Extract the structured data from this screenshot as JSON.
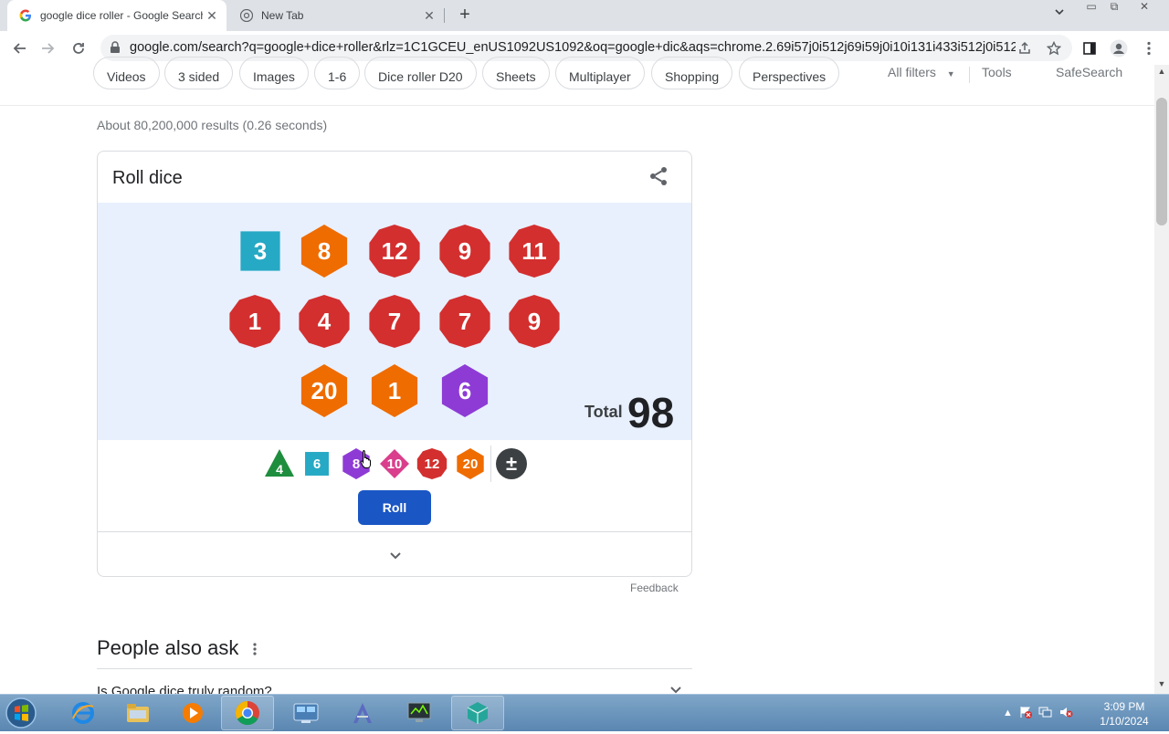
{
  "browser": {
    "tabs": [
      {
        "title": "google dice roller - Google Search",
        "active": true
      },
      {
        "title": "New Tab",
        "active": false
      }
    ],
    "url": "google.com/search?q=google+dice+roller&rlz=1C1GCEU_enUS1092US1092&oq=google+dic&aqs=chrome.2.69i57j0i512j69i59j0i10i131i433i512j0i512l4j..."
  },
  "search": {
    "chips": [
      "Videos",
      "3 sided",
      "Images",
      "1-6",
      "Dice roller D20",
      "Sheets",
      "Multiplayer",
      "Shopping",
      "Perspectives"
    ],
    "all_filters": "All filters",
    "tools": "Tools",
    "safesearch": "SafeSearch",
    "result_stats": "About 80,200,000 results (0.26 seconds)"
  },
  "dice_card": {
    "title": "Roll dice",
    "rolled_dice": [
      {
        "value": "3",
        "sides": 6,
        "color": "#26a9c4"
      },
      {
        "value": "8",
        "sides": 8,
        "color": "#ef6c00"
      },
      {
        "value": "12",
        "sides": 12,
        "color": "#d32f2f"
      },
      {
        "value": "9",
        "sides": 12,
        "color": "#d32f2f"
      },
      {
        "value": "11",
        "sides": 12,
        "color": "#d32f2f"
      },
      {
        "value": "1",
        "sides": 12,
        "color": "#d32f2f"
      },
      {
        "value": "4",
        "sides": 12,
        "color": "#d32f2f"
      },
      {
        "value": "7",
        "sides": 12,
        "color": "#d32f2f"
      },
      {
        "value": "7",
        "sides": 12,
        "color": "#d32f2f"
      },
      {
        "value": "9",
        "sides": 12,
        "color": "#d32f2f"
      },
      {
        "value": "20",
        "sides": 20,
        "color": "#ef6c00"
      },
      {
        "value": "1",
        "sides": 20,
        "color": "#ef6c00"
      },
      {
        "value": "6",
        "sides": 8,
        "color": "#8e3bd6"
      }
    ],
    "total_label": "Total",
    "total_value": "98",
    "die_selectors": [
      {
        "label": "4",
        "color": "#1e8e3e"
      },
      {
        "label": "6",
        "color": "#26a9c4"
      },
      {
        "label": "8",
        "color": "#8e3bd6"
      },
      {
        "label": "10",
        "color": "#d93f8c"
      },
      {
        "label": "12",
        "color": "#d32f2f"
      },
      {
        "label": "20",
        "color": "#ef6c00"
      },
      {
        "label": "±",
        "color": "#3c4043"
      }
    ],
    "roll_label": "Roll",
    "feedback": "Feedback"
  },
  "people_also_ask": {
    "title": "People also ask",
    "first_question": "Is Google dice truly random?"
  },
  "taskbar": {
    "time": "3:09 PM",
    "date": "1/10/2024"
  },
  "colors": {
    "accent": "#1a56c4",
    "dice_area_bg": "#e8f0fe"
  }
}
